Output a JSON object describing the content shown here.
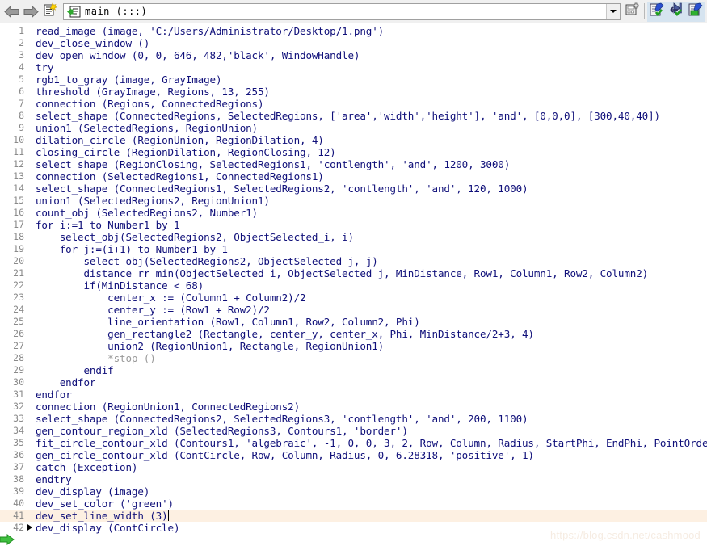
{
  "toolbar": {
    "back_label": "Back",
    "forward_label": "Forward",
    "procedures_label": "Procedures",
    "combo": {
      "value": "main (:::)",
      "icon": "procedure-icon"
    },
    "dropdown_label": "Open procedure list",
    "new_procedure_label": "New Procedure",
    "buttons": [
      {
        "name": "insert-operator-button",
        "label": "Insert Operator"
      },
      {
        "name": "step-over-button",
        "label": "Step Over"
      },
      {
        "name": "apply-button",
        "label": "Apply"
      }
    ]
  },
  "editor": {
    "current_line": 41,
    "marker_line": 42,
    "execution_arrow_line": 43,
    "lines": [
      {
        "n": 1,
        "text": "read_image (image, 'C:/Users/Administrator/Desktop/1.png')",
        "comment": false
      },
      {
        "n": 2,
        "text": "dev_close_window ()",
        "comment": false
      },
      {
        "n": 3,
        "text": "dev_open_window (0, 0, 646, 482,'black', WindowHandle)",
        "comment": false
      },
      {
        "n": 4,
        "text": "try",
        "comment": false
      },
      {
        "n": 5,
        "text": "rgb1_to_gray (image, GrayImage)",
        "comment": false
      },
      {
        "n": 6,
        "text": "threshold (GrayImage, Regions, 13, 255)",
        "comment": false
      },
      {
        "n": 7,
        "text": "connection (Regions, ConnectedRegions)",
        "comment": false
      },
      {
        "n": 8,
        "text": "select_shape (ConnectedRegions, SelectedRegions, ['area','width','height'], 'and', [0,0,0], [300,40,40])",
        "comment": false
      },
      {
        "n": 9,
        "text": "union1 (SelectedRegions, RegionUnion)",
        "comment": false
      },
      {
        "n": 10,
        "text": "dilation_circle (RegionUnion, RegionDilation, 4)",
        "comment": false
      },
      {
        "n": 11,
        "text": "closing_circle (RegionDilation, RegionClosing, 12)",
        "comment": false
      },
      {
        "n": 12,
        "text": "select_shape (RegionClosing, SelectedRegions1, 'contlength', 'and', 1200, 3000)",
        "comment": false
      },
      {
        "n": 13,
        "text": "connection (SelectedRegions1, ConnectedRegions1)",
        "comment": false
      },
      {
        "n": 14,
        "text": "select_shape (ConnectedRegions1, SelectedRegions2, 'contlength', 'and', 120, 1000)",
        "comment": false
      },
      {
        "n": 15,
        "text": "union1 (SelectedRegions2, RegionUnion1)",
        "comment": false
      },
      {
        "n": 16,
        "text": "count_obj (SelectedRegions2, Number1)",
        "comment": false
      },
      {
        "n": 17,
        "text": "for i:=1 to Number1 by 1",
        "comment": false
      },
      {
        "n": 18,
        "text": "    select_obj(SelectedRegions2, ObjectSelected_i, i)",
        "comment": false
      },
      {
        "n": 19,
        "text": "    for j:=(i+1) to Number1 by 1",
        "comment": false
      },
      {
        "n": 20,
        "text": "        select_obj(SelectedRegions2, ObjectSelected_j, j)",
        "comment": false
      },
      {
        "n": 21,
        "text": "        distance_rr_min(ObjectSelected_i, ObjectSelected_j, MinDistance, Row1, Column1, Row2, Column2)",
        "comment": false
      },
      {
        "n": 22,
        "text": "        if(MinDistance < 68)",
        "comment": false
      },
      {
        "n": 23,
        "text": "            center_x := (Column1 + Column2)/2",
        "comment": false
      },
      {
        "n": 24,
        "text": "            center_y := (Row1 + Row2)/2",
        "comment": false
      },
      {
        "n": 25,
        "text": "            line_orientation (Row1, Column1, Row2, Column2, Phi)",
        "comment": false
      },
      {
        "n": 26,
        "text": "            gen_rectangle2 (Rectangle, center_y, center_x, Phi, MinDistance/2+3, 4)",
        "comment": false
      },
      {
        "n": 27,
        "text": "            union2 (RegionUnion1, Rectangle, RegionUnion1)",
        "comment": false
      },
      {
        "n": 28,
        "text": "            *stop ()",
        "comment": true
      },
      {
        "n": 29,
        "text": "        endif",
        "comment": false
      },
      {
        "n": 30,
        "text": "    endfor",
        "comment": false
      },
      {
        "n": 31,
        "text": "endfor",
        "comment": false
      },
      {
        "n": 32,
        "text": "connection (RegionUnion1, ConnectedRegions2)",
        "comment": false
      },
      {
        "n": 33,
        "text": "select_shape (ConnectedRegions2, SelectedRegions3, 'contlength', 'and', 200, 1100)",
        "comment": false
      },
      {
        "n": 34,
        "text": "gen_contour_region_xld (SelectedRegions3, Contours1, 'border')",
        "comment": false
      },
      {
        "n": 35,
        "text": "fit_circle_contour_xld (Contours1, 'algebraic', -1, 0, 0, 3, 2, Row, Column, Radius, StartPhi, EndPhi, PointOrder)",
        "comment": false
      },
      {
        "n": 36,
        "text": "gen_circle_contour_xld (ContCircle, Row, Column, Radius, 0, 6.28318, 'positive', 1)",
        "comment": false
      },
      {
        "n": 37,
        "text": "catch (Exception)",
        "comment": false
      },
      {
        "n": 38,
        "text": "endtry",
        "comment": false
      },
      {
        "n": 39,
        "text": "dev_display (image)",
        "comment": false
      },
      {
        "n": 40,
        "text": "dev_set_color ('green')",
        "comment": false
      },
      {
        "n": 41,
        "text": "dev_set_line_width (3)",
        "comment": false
      },
      {
        "n": 42,
        "text": "dev_display (ContCircle)",
        "comment": false
      }
    ]
  },
  "watermark": {
    "text": "https://blog.csdn.net/cashmood"
  },
  "colors": {
    "code_text": "#10107a",
    "comment_text": "#9a9a9a",
    "line_number": "#8a8a8a",
    "current_line_bg": "#fdf0e2",
    "toolbar_bg": "#f0f0f0",
    "editor_bg": "#ffffff"
  }
}
